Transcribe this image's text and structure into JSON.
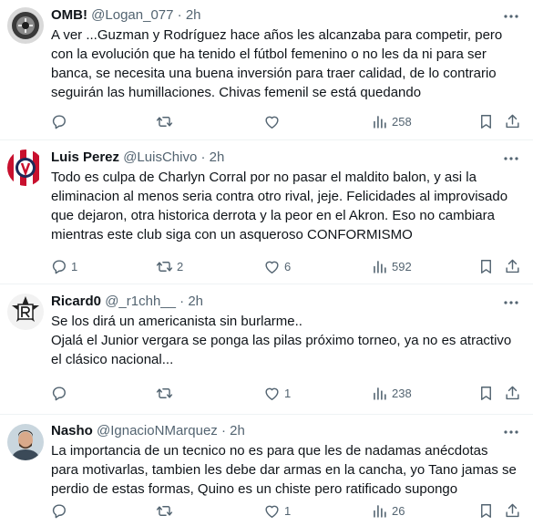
{
  "tweets": [
    {
      "name": "OMB!",
      "handle": "@Logan_077",
      "dot": "·",
      "time": "2h",
      "text": "A ver ...Guzman y Rodríguez hace años les alcanzaba para competir, pero con la evolución que ha tenido el fútbol femenino o no les da ni para ser banca, se necesita una buena inversión para traer calidad, de lo contrario seguirán las humillaciones. Chivas femenil se está quedando",
      "replies": "",
      "retweets": "",
      "likes": "",
      "views": "258"
    },
    {
      "name": "Luis Perez",
      "handle": "@LuisChivo",
      "dot": "·",
      "time": "2h",
      "text": "Todo es culpa de Charlyn Corral por no pasar el maldito balon, y asi la eliminacion al menos seria contra otro rival, jeje. Felicidades al improvisado que dejaron, otra historica derrota y la peor en el Akron. Eso no cambiara mientras este club siga con un asqueroso CONFORMISMO",
      "replies": "1",
      "retweets": "2",
      "likes": "6",
      "views": "592"
    },
    {
      "name": "Ricard0",
      "handle": "@_r1chh__",
      "dot": "·",
      "time": "2h",
      "text": "Se los dirá un americanista sin burlarme..\nOjalá el Junior vergara se ponga las pilas próximo torneo, ya no es atractivo el clásico nacional...",
      "replies": "",
      "retweets": "",
      "likes": "1",
      "views": "238"
    },
    {
      "name": "Nasho",
      "handle": "@IgnacioNMarquez",
      "dot": "·",
      "time": "2h",
      "text": "La importancia de un tecnico no es para que les de nadamas anécdotas para motivarlas, tambien les debe dar armas en la cancha, yo Tano jamas se perdio de estas formas, Quino es un chiste pero ratificado supongo",
      "replies": "",
      "retweets": "",
      "likes": "1",
      "views": "26"
    }
  ],
  "icons": {
    "reply": "reply-icon",
    "retweet": "retweet-icon",
    "like": "like-icon",
    "views": "views-icon",
    "bookmark": "bookmark-icon",
    "share": "share-icon",
    "more": "more-icon"
  },
  "colors": {
    "text": "#0f1419",
    "secondary": "#536471",
    "divider": "#eff3f4"
  }
}
